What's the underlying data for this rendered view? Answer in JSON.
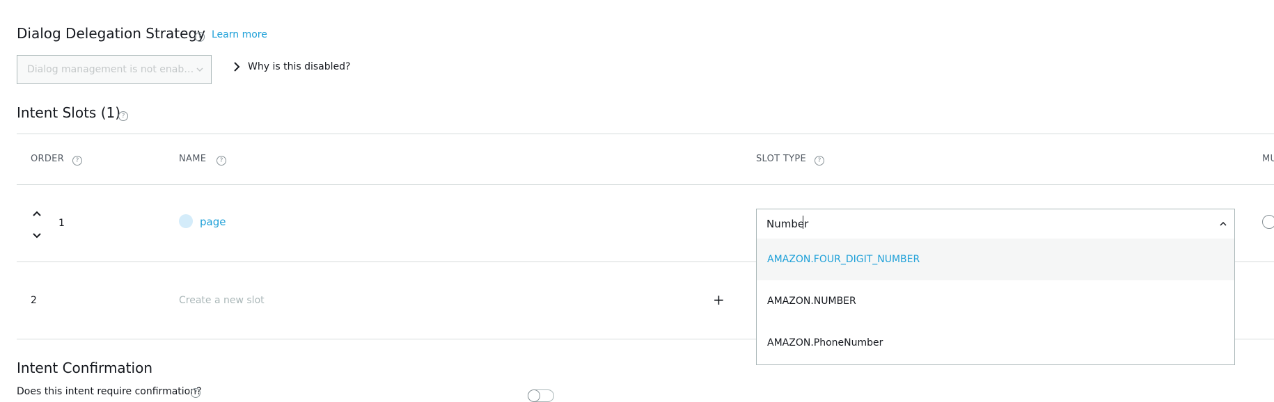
{
  "delegation": {
    "title": "Dialog Delegation Strategy",
    "learn_more": "Learn more",
    "select_value": "Dialog management is not enabled f...",
    "why_disabled": "Why is this disabled?"
  },
  "slots": {
    "title": "Intent Slots (1)",
    "columns": {
      "order": "ORDER",
      "name": "NAME",
      "slot_type": "SLOT TYPE",
      "multi": "MU"
    },
    "rows": [
      {
        "order": "1",
        "name": "page"
      },
      {
        "order": "2",
        "name_placeholder": "Create a new slot",
        "add": "+"
      }
    ],
    "slot_type_input": "Number",
    "options": [
      "AMAZON.FOUR_DIGIT_NUMBER",
      "AMAZON.NUMBER",
      "AMAZON.PhoneNumber"
    ]
  },
  "confirmation": {
    "title": "Intent Confirmation",
    "question": "Does this intent require confirmation?"
  },
  "colors": {
    "link": "#1ea0d8",
    "border": "#aab7b8",
    "highlight_bg": "#f5f6f6"
  }
}
